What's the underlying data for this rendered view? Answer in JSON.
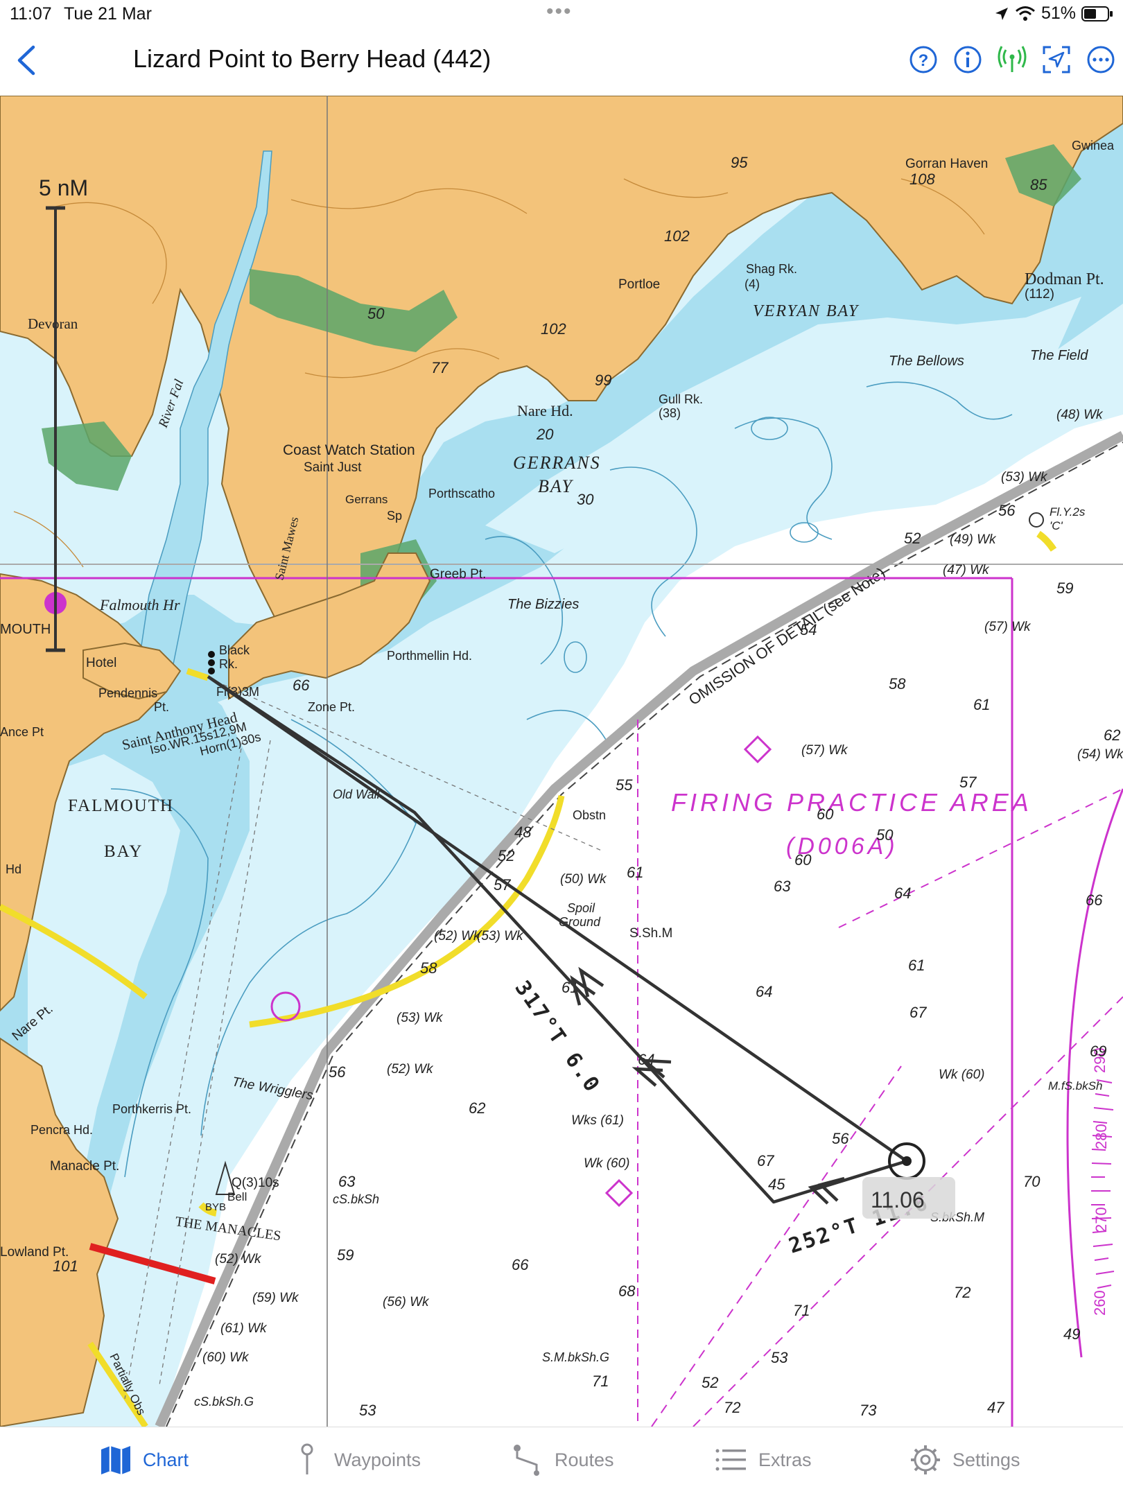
{
  "status_bar": {
    "time": "11:07",
    "date": "Tue 21 Mar",
    "battery": "51%"
  },
  "nav": {
    "title": "Lizard Point to Berry Head (442)",
    "icons": [
      "back-chevron-icon",
      "help-icon",
      "info-icon",
      "signal-icon",
      "ar-locate-icon",
      "more-icon"
    ]
  },
  "map": {
    "scale_label": "5 nM",
    "place_labels": [
      "Devoran",
      "River Fal",
      "Coast Watch Station",
      "Saint Just",
      "Gerrans",
      "Sp",
      "Saint Mawes",
      "Porthscatho",
      "GERRANS",
      "BAY",
      "Nare Hd.",
      "Portloe",
      "Shag Rk.",
      "(4)",
      "VERYAN BAY",
      "Gull Rk.",
      "(38)",
      "The Bellows",
      "The Field",
      "Dodman Pt.",
      "(112)",
      "Gorran Haven",
      "Gwinea",
      "Greeb Pt.",
      "The Bizzies",
      "Falmouth Hr",
      "MOUTH",
      "Hotel",
      "Pendennis",
      "Pt.",
      "Black",
      "Rk.",
      "Fl(3)3M",
      "Porthmellin Hd.",
      "Zone Pt.",
      "Saint Anthony Head",
      "Iso.WR.15s12,9M",
      "Horn(1)30s",
      "FALMOUTH",
      "BAY",
      "Old Wall",
      "Obstn",
      "Spoil",
      "Ground",
      "S.Sh.M",
      "Nare Pt.",
      "The Wrigglers",
      "Porthkerris Pt.",
      "Pencra Hd.",
      "Manacle Pt.",
      "Q(3)10s",
      "Bell",
      "BYB",
      "THE MANACLES",
      "Lowland Pt.",
      "cS.bkSh",
      "cS.bkSh.G",
      "S.M.bkSh.G",
      "M.fS.bkSh",
      "S.bkSh.M",
      "OMISSION OF DETAIL (see Note)",
      "FIRING PRACTICE AREA",
      "(D006A)",
      "Fl.Y.2s",
      "'C'",
      "Partially Obs",
      "Ance Pt",
      "Hd"
    ],
    "depths": [
      "95",
      "108",
      "85",
      "102",
      "102",
      "99",
      "77",
      "50",
      "20",
      "30",
      "66",
      "62",
      "63",
      "64",
      "66",
      "67",
      "64",
      "61",
      "58",
      "54",
      "59",
      "56",
      "52",
      "48",
      "55",
      "57",
      "58",
      "61",
      "62",
      "63",
      "56",
      "67",
      "66",
      "68",
      "71",
      "72",
      "73",
      "70",
      "71",
      "72",
      "69",
      "61",
      "64",
      "60",
      "53",
      "49",
      "47",
      "45",
      "50",
      "57",
      "52",
      "53",
      "59",
      "56",
      "61",
      "60",
      "52",
      "101"
    ],
    "wrecks": [
      "(53) Wk",
      "(49) Wk",
      "(47) Wk",
      "(57) Wk",
      "(48) Wk",
      "(57) Wk",
      "(54) Wk",
      "(50) Wk",
      "(52) Wk",
      "(53) Wk",
      "(53) Wk",
      "(52) Wk",
      "(52) Wk",
      "(59) Wk",
      "(56) Wk",
      "(61) Wk",
      "(60) Wk",
      "Wks (61)",
      "Wk (60)",
      "Wk (60)"
    ],
    "route": {
      "leg1_label": "317°T 6.0",
      "leg2_label": "252°T 11.6",
      "waypoint_label": "11.06"
    },
    "compass_labels": [
      "290",
      "280",
      "270",
      "260"
    ],
    "accent_colors": {
      "land": "#f3c37a",
      "shallow": "#a9dff0",
      "deep_shallow": "#d9f3fb",
      "sea": "#ffffff",
      "magenta": "#cc33cc",
      "route": "#333333",
      "sector_yellow": "#f1dd2a",
      "sector_red": "#e02020",
      "ui_blue": "#1f66d6",
      "ui_green": "#2fb84a"
    }
  },
  "tabs": [
    {
      "label": "Chart",
      "icon": "map-icon",
      "active": true
    },
    {
      "label": "Waypoints",
      "icon": "pin-icon",
      "active": false
    },
    {
      "label": "Routes",
      "icon": "route-icon",
      "active": false
    },
    {
      "label": "Extras",
      "icon": "list-icon",
      "active": false
    },
    {
      "label": "Settings",
      "icon": "gear-icon",
      "active": false
    }
  ]
}
